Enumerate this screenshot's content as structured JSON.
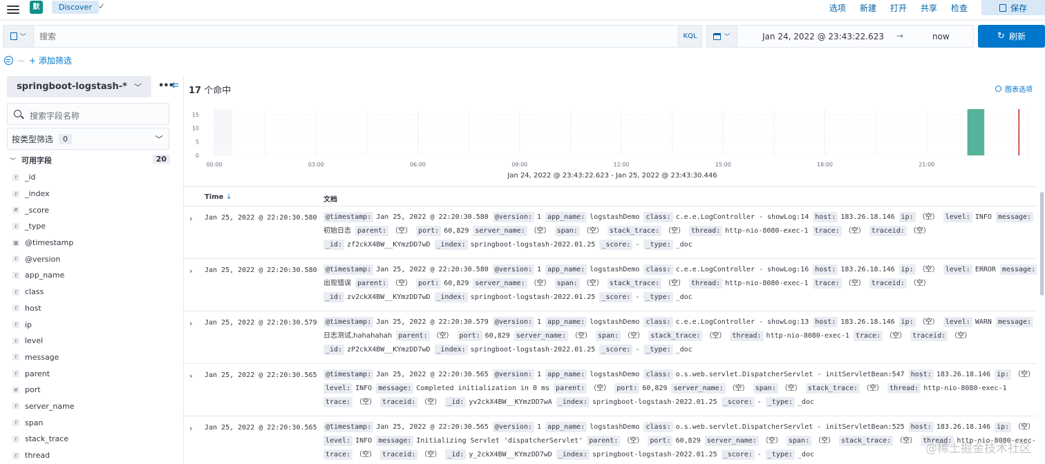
{
  "topbar": {
    "space_initial": "默",
    "app_name": "Discover",
    "nav": [
      "选项",
      "新建",
      "打开",
      "共享",
      "检查"
    ],
    "save_label": "保存"
  },
  "query": {
    "placeholder": "搜索",
    "language": "KQL"
  },
  "time": {
    "start": "Jan 24, 2022 @ 23:43:22.623",
    "arrow": "→",
    "end": "now",
    "refresh_label": "刷新"
  },
  "filters": {
    "dash": "—",
    "add_label": "+ 添加筛选"
  },
  "sidebar": {
    "index_pattern": "springboot-logstash-*",
    "more_icon": "•••",
    "collapse_icon": "⇇",
    "field_search_placeholder": "搜索字段名称",
    "type_filter_label": "按类型筛选",
    "type_filter_count": "0",
    "available_label": "可用字段",
    "available_count": "20",
    "fields": [
      {
        "name": "_id",
        "type": "t"
      },
      {
        "name": "_index",
        "type": "t"
      },
      {
        "name": "_score",
        "type": "#"
      },
      {
        "name": "_type",
        "type": "t"
      },
      {
        "name": "@timestamp",
        "type": "cal"
      },
      {
        "name": "@version",
        "type": "t"
      },
      {
        "name": "app_name",
        "type": "t"
      },
      {
        "name": "class",
        "type": "t"
      },
      {
        "name": "host",
        "type": "t"
      },
      {
        "name": "ip",
        "type": "t"
      },
      {
        "name": "level",
        "type": "t"
      },
      {
        "name": "message",
        "type": "t"
      },
      {
        "name": "parent",
        "type": "t"
      },
      {
        "name": "port",
        "type": "#"
      },
      {
        "name": "server_name",
        "type": "t"
      },
      {
        "name": "span",
        "type": "t"
      },
      {
        "name": "stack_trace",
        "type": "t"
      },
      {
        "name": "thread",
        "type": "t"
      }
    ]
  },
  "main": {
    "hits_count": "17",
    "hits_label": "个命中",
    "chart_options_label": "图表选项",
    "range_label": "Jan 24, 2022 @ 23:43:22.623 - Jan 25, 2022 @ 23:43:30.446",
    "col_time": "Time",
    "col_time_sort": "↓",
    "col_doc": "文档"
  },
  "chart_data": {
    "type": "bar",
    "x_ticks": [
      "00:00",
      "03:00",
      "06:00",
      "09:00",
      "12:00",
      "15:00",
      "18:00",
      "21:00"
    ],
    "y_ticks": [
      0,
      5,
      10,
      15
    ],
    "ylim": [
      0,
      17
    ],
    "bars": [
      {
        "hour": 22.2,
        "value": 17
      }
    ],
    "now_marker_hour": 23.72,
    "bar_color": "#54b399",
    "now_color": "#bd271e"
  },
  "rows": [
    {
      "time": "Jan 25, 2022 @ 22:20:30.580",
      "lines": [
        [
          [
            "@timestamp:",
            "Jan 25, 2022 @ 22:20:30.580"
          ],
          [
            "@version:",
            "1"
          ],
          [
            "app_name:",
            "logstashDemo"
          ],
          [
            "class:",
            "c.e.e.LogController - showLog:14"
          ],
          [
            "host:",
            "183.26.18.146"
          ],
          [
            "ip:",
            "（空）"
          ],
          [
            "level:",
            "INFO"
          ],
          [
            "message:",
            ""
          ]
        ],
        [
          [
            "",
            "初始日志"
          ],
          [
            "parent:",
            "（空）"
          ],
          [
            "port:",
            "60,829"
          ],
          [
            "server_name:",
            "（空）"
          ],
          [
            "span:",
            "（空）"
          ],
          [
            "stack_trace:",
            "（空）"
          ],
          [
            "thread:",
            "http-nio-8080-exec-1"
          ],
          [
            "trace:",
            "（空）"
          ],
          [
            "traceid:",
            "（空）"
          ]
        ],
        [
          [
            "_id:",
            "zf2ckX4BW__KYmzDD7wD"
          ],
          [
            "_index:",
            "springboot-logstash-2022.01.25"
          ],
          [
            "_score:",
            "-"
          ],
          [
            "_type:",
            "_doc"
          ]
        ]
      ]
    },
    {
      "time": "Jan 25, 2022 @ 22:20:30.580",
      "lines": [
        [
          [
            "@timestamp:",
            "Jan 25, 2022 @ 22:20:30.580"
          ],
          [
            "@version:",
            "1"
          ],
          [
            "app_name:",
            "logstashDemo"
          ],
          [
            "class:",
            "c.e.e.LogController - showLog:16"
          ],
          [
            "host:",
            "183.26.18.146"
          ],
          [
            "ip:",
            "（空）"
          ],
          [
            "level:",
            "ERROR"
          ],
          [
            "message:",
            ""
          ]
        ],
        [
          [
            "",
            "出现错误"
          ],
          [
            "parent:",
            "（空）"
          ],
          [
            "port:",
            "60,829"
          ],
          [
            "server_name:",
            "（空）"
          ],
          [
            "span:",
            "（空）"
          ],
          [
            "stack_trace:",
            "（空）"
          ],
          [
            "thread:",
            "http-nio-8080-exec-1"
          ],
          [
            "trace:",
            "（空）"
          ],
          [
            "traceid:",
            "（空）"
          ]
        ],
        [
          [
            "_id:",
            "zv2ckX4BW__KYmzDD7wD"
          ],
          [
            "_index:",
            "springboot-logstash-2022.01.25"
          ],
          [
            "_score:",
            "-"
          ],
          [
            "_type:",
            "_doc"
          ]
        ]
      ]
    },
    {
      "time": "Jan 25, 2022 @ 22:20:30.579",
      "lines": [
        [
          [
            "@timestamp:",
            "Jan 25, 2022 @ 22:20:30.579"
          ],
          [
            "@version:",
            "1"
          ],
          [
            "app_name:",
            "logstashDemo"
          ],
          [
            "class:",
            "c.e.e.LogController - showLog:13"
          ],
          [
            "host:",
            "183.26.18.146"
          ],
          [
            "ip:",
            "（空）"
          ],
          [
            "level:",
            "WARN"
          ],
          [
            "message:",
            ""
          ]
        ],
        [
          [
            "",
            "日志测试,hahahahah"
          ],
          [
            "parent:",
            "（空）"
          ],
          [
            "port:",
            "60,829"
          ],
          [
            "server_name:",
            "（空）"
          ],
          [
            "span:",
            "（空）"
          ],
          [
            "stack_trace:",
            "（空）"
          ],
          [
            "thread:",
            "http-nio-8080-exec-1"
          ],
          [
            "trace:",
            "（空）"
          ],
          [
            "traceid:",
            "（空）"
          ]
        ],
        [
          [
            "_id:",
            "zP2ckX4BW__KYmzDD7wD"
          ],
          [
            "_index:",
            "springboot-logstash-2022.01.25"
          ],
          [
            "_score:",
            "-"
          ],
          [
            "_type:",
            "_doc"
          ]
        ]
      ]
    },
    {
      "time": "Jan 25, 2022 @ 22:20:30.565",
      "lines": [
        [
          [
            "@timestamp:",
            "Jan 25, 2022 @ 22:20:30.565"
          ],
          [
            "@version:",
            "1"
          ],
          [
            "app_name:",
            "logstashDemo"
          ],
          [
            "class:",
            "o.s.web.servlet.DispatcherServlet - initServletBean:547"
          ],
          [
            "host:",
            "183.26.18.146"
          ],
          [
            "ip:",
            "（空）"
          ]
        ],
        [
          [
            "level:",
            "INFO"
          ],
          [
            "message:",
            "Completed initialization in 0 ms"
          ],
          [
            "parent:",
            "（空）"
          ],
          [
            "port:",
            "60,829"
          ],
          [
            "server_name:",
            "（空）"
          ],
          [
            "span:",
            "（空）"
          ],
          [
            "stack_trace:",
            "（空）"
          ],
          [
            "thread:",
            "http-nio-8080-exec-1"
          ]
        ],
        [
          [
            "trace:",
            "（空）"
          ],
          [
            "traceid:",
            "（空）"
          ],
          [
            "_id:",
            "yv2ckX4BW__KYmzDD7wA"
          ],
          [
            "_index:",
            "springboot-logstash-2022.01.25"
          ],
          [
            "_score:",
            "-"
          ],
          [
            "_type:",
            "_doc"
          ]
        ]
      ]
    },
    {
      "time": "Jan 25, 2022 @ 22:20:30.565",
      "lines": [
        [
          [
            "@timestamp:",
            "Jan 25, 2022 @ 22:20:30.565"
          ],
          [
            "@version:",
            "1"
          ],
          [
            "app_name:",
            "logstashDemo"
          ],
          [
            "class:",
            "o.s.web.servlet.DispatcherServlet - initServletBean:525"
          ],
          [
            "host:",
            "183.26.18.146"
          ],
          [
            "ip:",
            "（空）"
          ]
        ],
        [
          [
            "level:",
            "INFO"
          ],
          [
            "message:",
            "Initializing Servlet 'dispatcherServlet'"
          ],
          [
            "parent:",
            "（空）"
          ],
          [
            "port:",
            "60,829"
          ],
          [
            "server_name:",
            "（空）"
          ],
          [
            "span:",
            "（空）"
          ],
          [
            "stack_trace:",
            "（空）"
          ],
          [
            "thread:",
            "http-nio-8080-exec-1"
          ]
        ],
        [
          [
            "trace:",
            "（空）"
          ],
          [
            "traceid:",
            "（空）"
          ],
          [
            "_id:",
            "y_2ckX4BW__KYmzDD7wD"
          ],
          [
            "_index:",
            "springboot-logstash-2022.01.25"
          ],
          [
            "_score:",
            "-"
          ],
          [
            "_type:",
            "_doc"
          ]
        ]
      ]
    }
  ],
  "watermark": "@稀土掘金技术社区"
}
